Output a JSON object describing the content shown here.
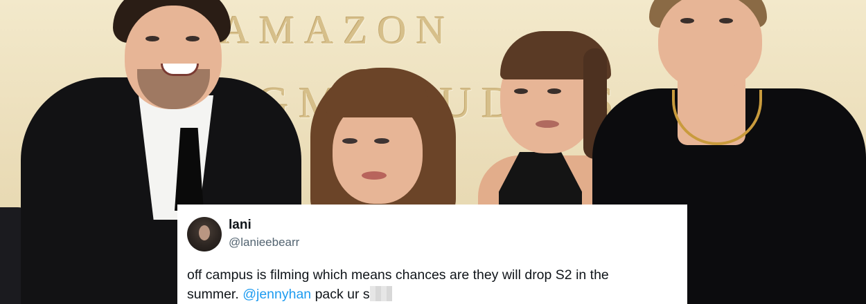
{
  "photo": {
    "backdrop_line1": "AMAZON",
    "backdrop_line2": "MGM STUDIOS"
  },
  "tweet": {
    "display_name": "lani",
    "handle": "@lanieebearr",
    "text_line1": "off campus is filming which means chances are they will drop S2 in the",
    "text_line2_start": "summer.",
    "mention": "@jennyhan",
    "text_line2_end": "pack ur s",
    "colors": {
      "text": "#0f1419",
      "secondary": "#536471",
      "mention": "#1d9bf0",
      "background": "#ffffff"
    },
    "avatar_icon": "profile-avatar"
  }
}
